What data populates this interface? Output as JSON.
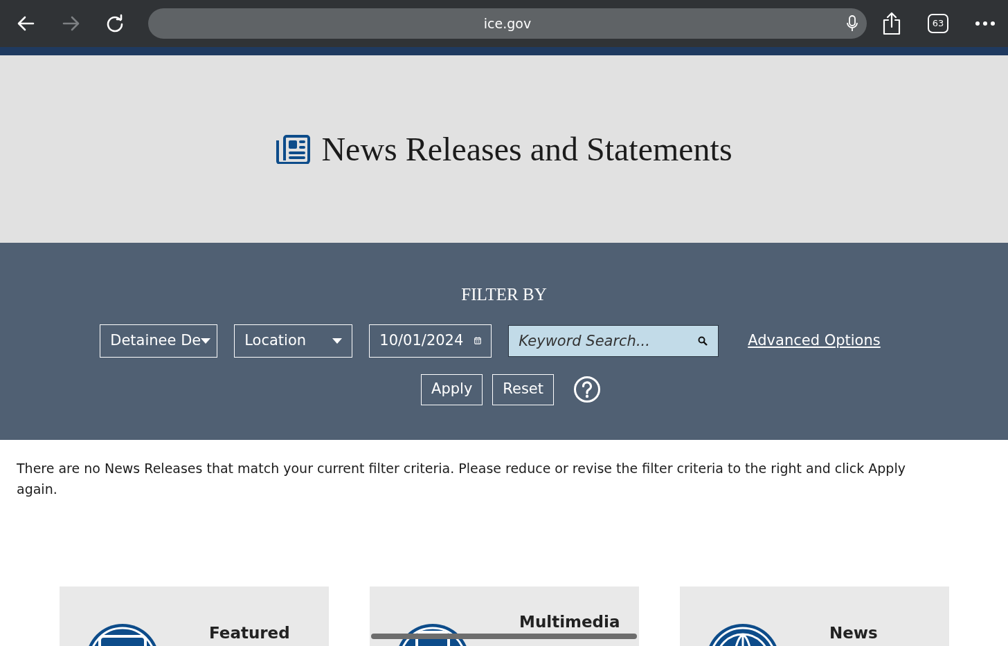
{
  "browser": {
    "nav_buttons": [
      {
        "kind": "back",
        "disabled": false
      },
      {
        "kind": "forward",
        "disabled": true
      },
      {
        "kind": "reload",
        "disabled": false
      }
    ],
    "url": "ice.gov",
    "tab_count": "63"
  },
  "header": {
    "title": "News Releases and Statements"
  },
  "filter": {
    "heading": "FILTER BY",
    "dropdowns": [
      {
        "value": "Detainee De"
      },
      {
        "value": "Location"
      }
    ],
    "date": "10/01/2024",
    "search": {
      "placeholder": "Keyword Search..."
    },
    "link": "Advanced Options",
    "buttons": [
      "Apply",
      "Reset"
    ]
  },
  "message": "There are no News Releases that match your current filter criteria. Please reduce or revise the filter criteria to the right and click Apply again.",
  "cards": [
    {
      "title": "Featured",
      "kind": "featured"
    },
    {
      "title": "Multimedia",
      "kind": "multimedia"
    },
    {
      "title": "News",
      "kind": "news"
    }
  ]
}
